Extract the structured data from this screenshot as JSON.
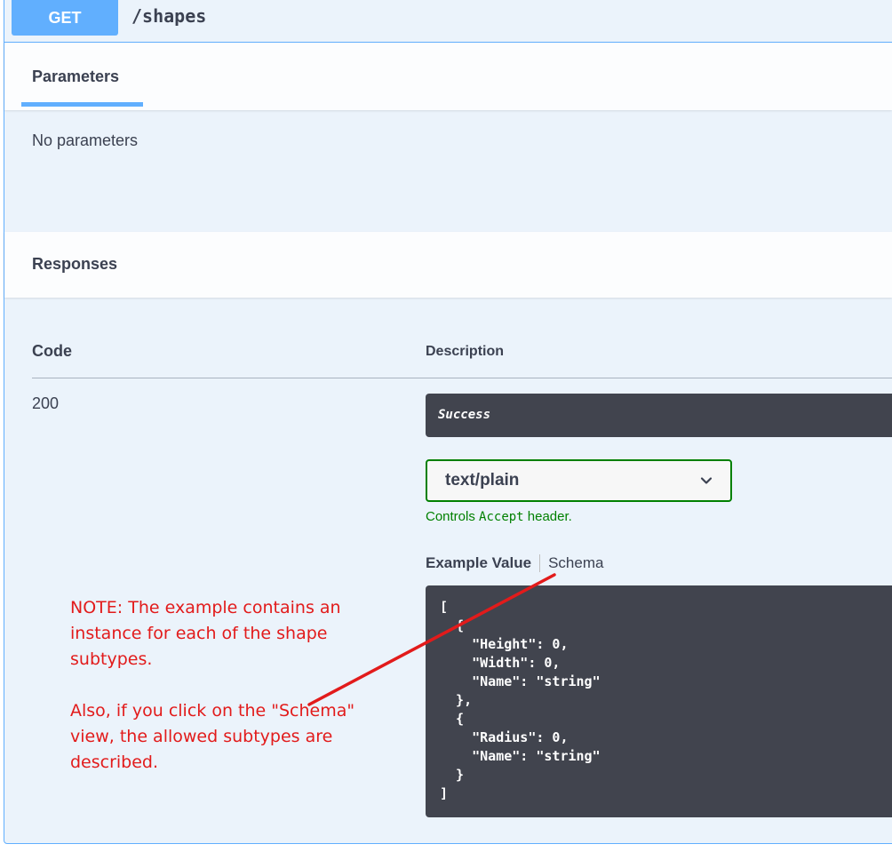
{
  "operation": {
    "method": "GET",
    "path": "/shapes"
  },
  "parameters": {
    "tab_label": "Parameters",
    "empty_text": "No parameters"
  },
  "responses": {
    "title": "Responses",
    "columns": {
      "code": "Code",
      "description": "Description"
    },
    "rows": [
      {
        "code": "200",
        "description": "Success"
      }
    ],
    "media_type": {
      "selected": "text/plain",
      "hint_prefix": "Controls",
      "hint_code": "Accept",
      "hint_suffix": "header."
    },
    "example_tabs": {
      "example_value": "Example Value",
      "schema": "Schema"
    },
    "example_json": "[\n  {\n    \"Height\": 0,\n    \"Width\": 0,\n    \"Name\": \"string\"\n  },\n  {\n    \"Radius\": 0,\n    \"Name\": \"string\"\n  }\n]"
  },
  "annotation": {
    "note_paragraph_1": "NOTE: The example contains an instance for each of the shape subtypes.",
    "note_paragraph_2": "Also, if you click on the \"Schema\" view, the allowed subtypes are described.",
    "color": "#e21b1b"
  },
  "colors": {
    "get_blue": "#61affe",
    "panel_bg": "#ebf3fb",
    "code_bg": "#41444e",
    "accept_green": "#008000"
  }
}
